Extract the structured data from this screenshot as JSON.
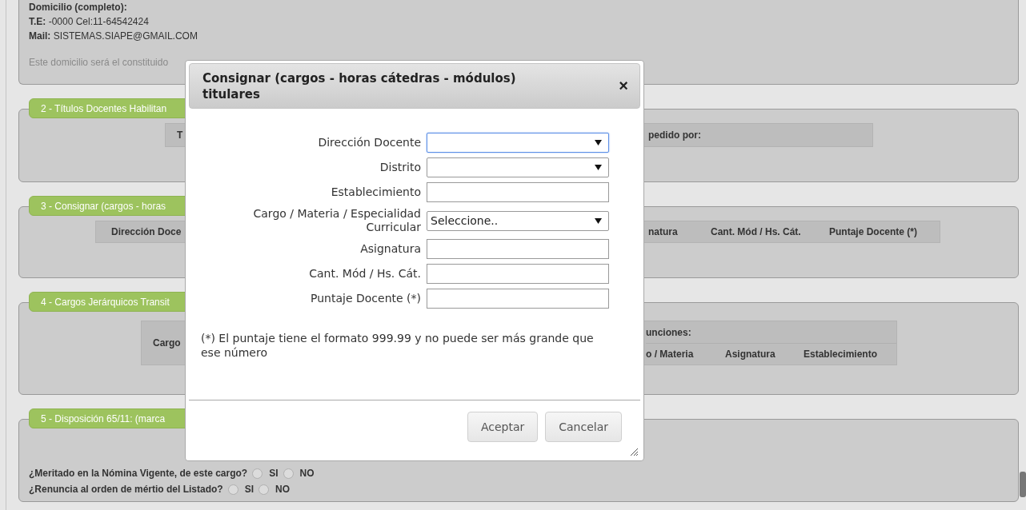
{
  "contact": {
    "lines": [
      {
        "label": "Domicilio (completo):"
      },
      {
        "label": "T.E:",
        "value": "-0000 Cel:11-64542424"
      },
      {
        "label": "Mail:",
        "value": "SISTEMAS.SIAPE@GMAIL.COM"
      }
    ],
    "note": "Este domicilio será el constituido"
  },
  "sections": [
    {
      "kind": "table",
      "title": "2 - Títulos Docentes Habilitan",
      "cells": [
        "T",
        "pedido por:"
      ]
    },
    {
      "kind": "table",
      "title": "3 - Consignar (cargos - horas",
      "cells": [
        "Dirección Doce",
        "",
        "natura",
        "Cant. Mód / Hs. Cát.",
        "Puntaje Docente (*)"
      ]
    },
    {
      "kind": "grouped_table",
      "title": "4 - Cargos Jerárquicos Transit",
      "side": "Cargo",
      "group": "unciones:",
      "cells": [
        "o / Materia",
        "Asignatura",
        "Establecimiento"
      ]
    },
    {
      "kind": "questions",
      "title": "5 - Disposición 65/11: (marca",
      "questions": [
        {
          "text": "¿Meritado en la Nómina Vigente, de este cargo?",
          "options": [
            {
              "label": "SI",
              "selected": false
            },
            {
              "label": "NO",
              "selected": false
            }
          ]
        },
        {
          "text": "¿Renuncia al orden de mértio del Listado?",
          "options": [
            {
              "label": "SI",
              "selected": false
            },
            {
              "label": "NO",
              "selected": false
            }
          ]
        }
      ]
    }
  ],
  "dialog": {
    "title": "Consignar (cargos - horas cátedras - módulos) titulares",
    "close": "×",
    "fields": [
      {
        "kind": "select",
        "label": "Dirección Docente",
        "focused": true
      },
      {
        "kind": "select",
        "label": "Distrito",
        "focused": false
      },
      {
        "kind": "text",
        "label": "Establecimiento",
        "focused": false
      },
      {
        "kind": "select",
        "label": "Cargo / Materia / Especialidad Curricular",
        "value": "Seleccione..",
        "focused": false
      },
      {
        "kind": "text",
        "label": "Asignatura",
        "focused": false
      },
      {
        "kind": "text",
        "label": "Cant. Mód / Hs. Cát.",
        "focused": false
      },
      {
        "kind": "text",
        "label": "Puntaje Docente (*)",
        "focused": false
      }
    ],
    "note": "(*) El puntaje tiene el formato 999.99 y no puede ser más grande que ese número",
    "buttons": [
      "Aceptar",
      "Cancelar"
    ]
  }
}
